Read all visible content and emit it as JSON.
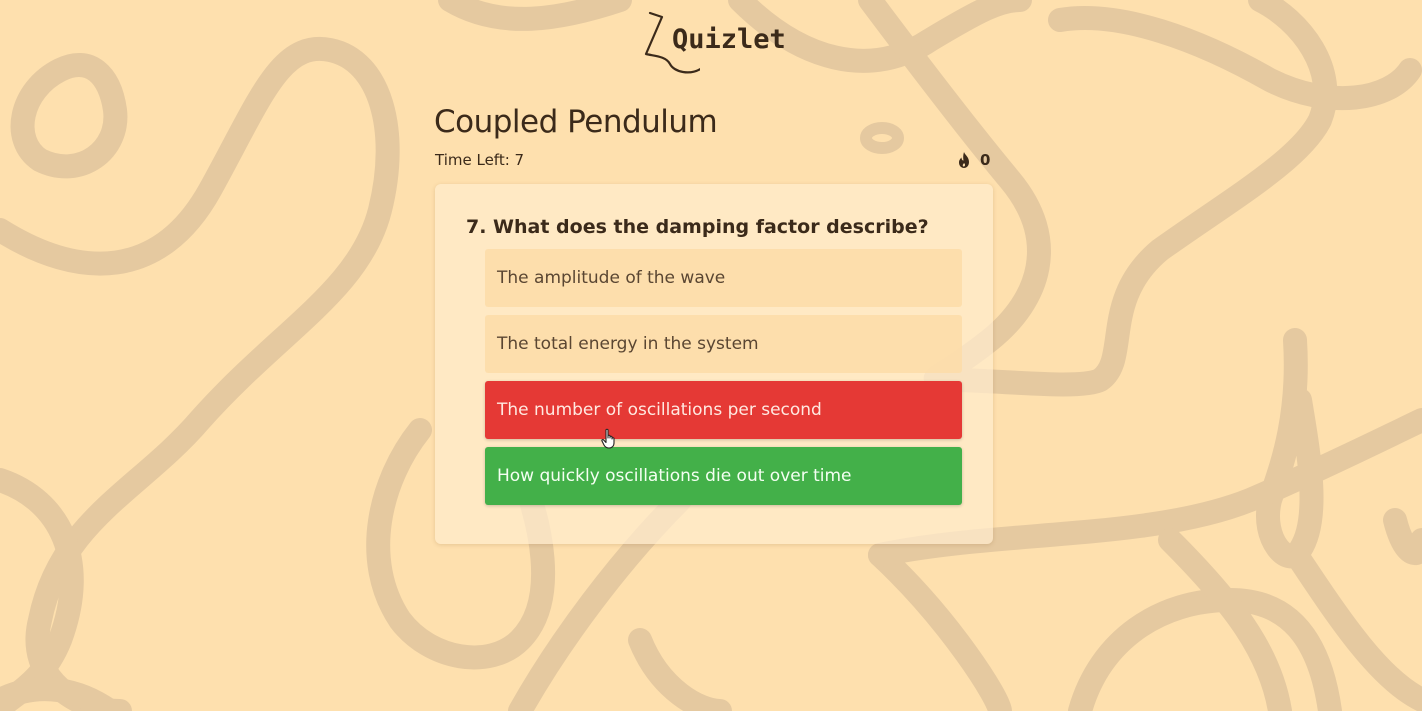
{
  "app": {
    "logo_text": "Quizlet"
  },
  "quiz": {
    "title": "Coupled Pendulum",
    "timer_label": "Time Left: 7",
    "streak_count": "0"
  },
  "question": {
    "text": "7. What does the damping factor describe?",
    "options": [
      {
        "label": "The amplitude of the wave",
        "state": "neutral"
      },
      {
        "label": "The total energy in the system",
        "state": "neutral"
      },
      {
        "label": "The number of oscillations per second",
        "state": "incorrect"
      },
      {
        "label": "How quickly oscillations die out over time",
        "state": "correct"
      }
    ]
  },
  "colors": {
    "background": "#fee0ae",
    "decor_lines": "#e5c9a0",
    "incorrect": "#e53935",
    "correct": "#43b049",
    "text": "#3b2a1a"
  },
  "icons": {
    "streak": "flame-icon",
    "cursor": "hand-pointer-icon"
  }
}
